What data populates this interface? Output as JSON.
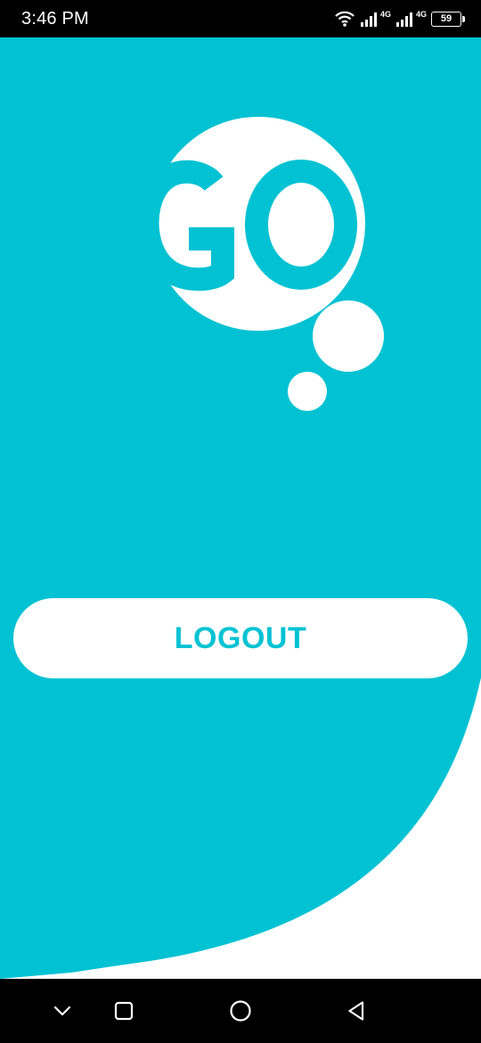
{
  "status_bar": {
    "time": "3:46 PM",
    "network_label_1": "4G",
    "network_label_2": "4G",
    "battery_level": "59",
    "icons": [
      "wifi-icon",
      "signal-icon",
      "signal-icon",
      "battery-icon"
    ]
  },
  "logo": {
    "text": "GO",
    "icon": "go-logo-icon"
  },
  "main": {
    "logout_label": "LOGOUT"
  },
  "nav_bar": {
    "icons": [
      "chevron-down-icon",
      "recent-apps-icon",
      "home-icon",
      "back-icon"
    ]
  },
  "colors": {
    "teal": "#00c2d3",
    "white": "#ffffff",
    "black": "#000000"
  }
}
